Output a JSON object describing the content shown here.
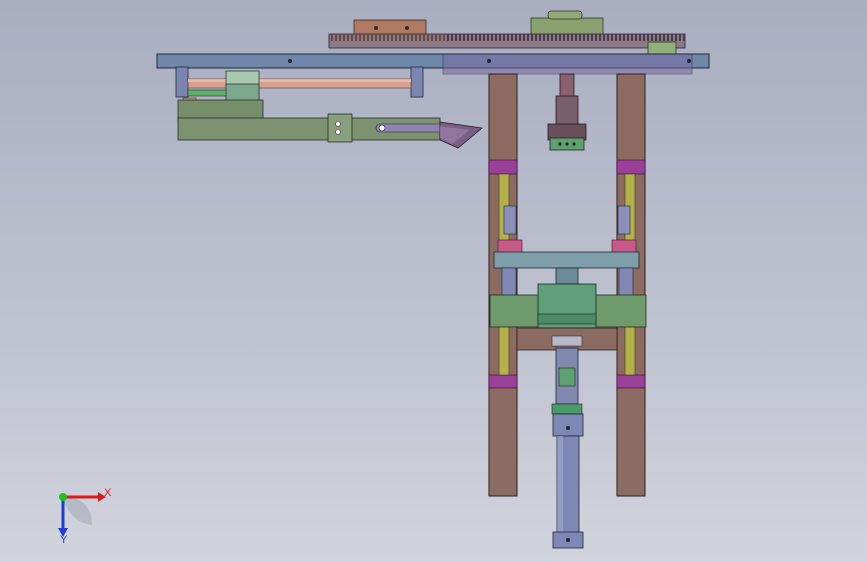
{
  "viewport": {
    "background_top": "#a9aec0",
    "background_bottom": "#d2d4dd"
  },
  "triad": {
    "x_label": "X",
    "y_label": "Y",
    "x_color": "#d21e1e",
    "y_color": "#1fbf1f",
    "z_color": "#1e3fd2"
  },
  "model": {
    "part_colors": {
      "frame_post": "#8a6a5e",
      "top_plate": "#6e86a8",
      "gear_rack": "#7c6e7c",
      "gear_brown": "#a0715c",
      "cylinder_blue": "#7d86ad",
      "accent_magenta": "#9a3f9a",
      "guide_rod_yellow": "#a5a34a",
      "green_block": "#5f9a7a",
      "arm_olive": "#6f8a66"
    }
  }
}
